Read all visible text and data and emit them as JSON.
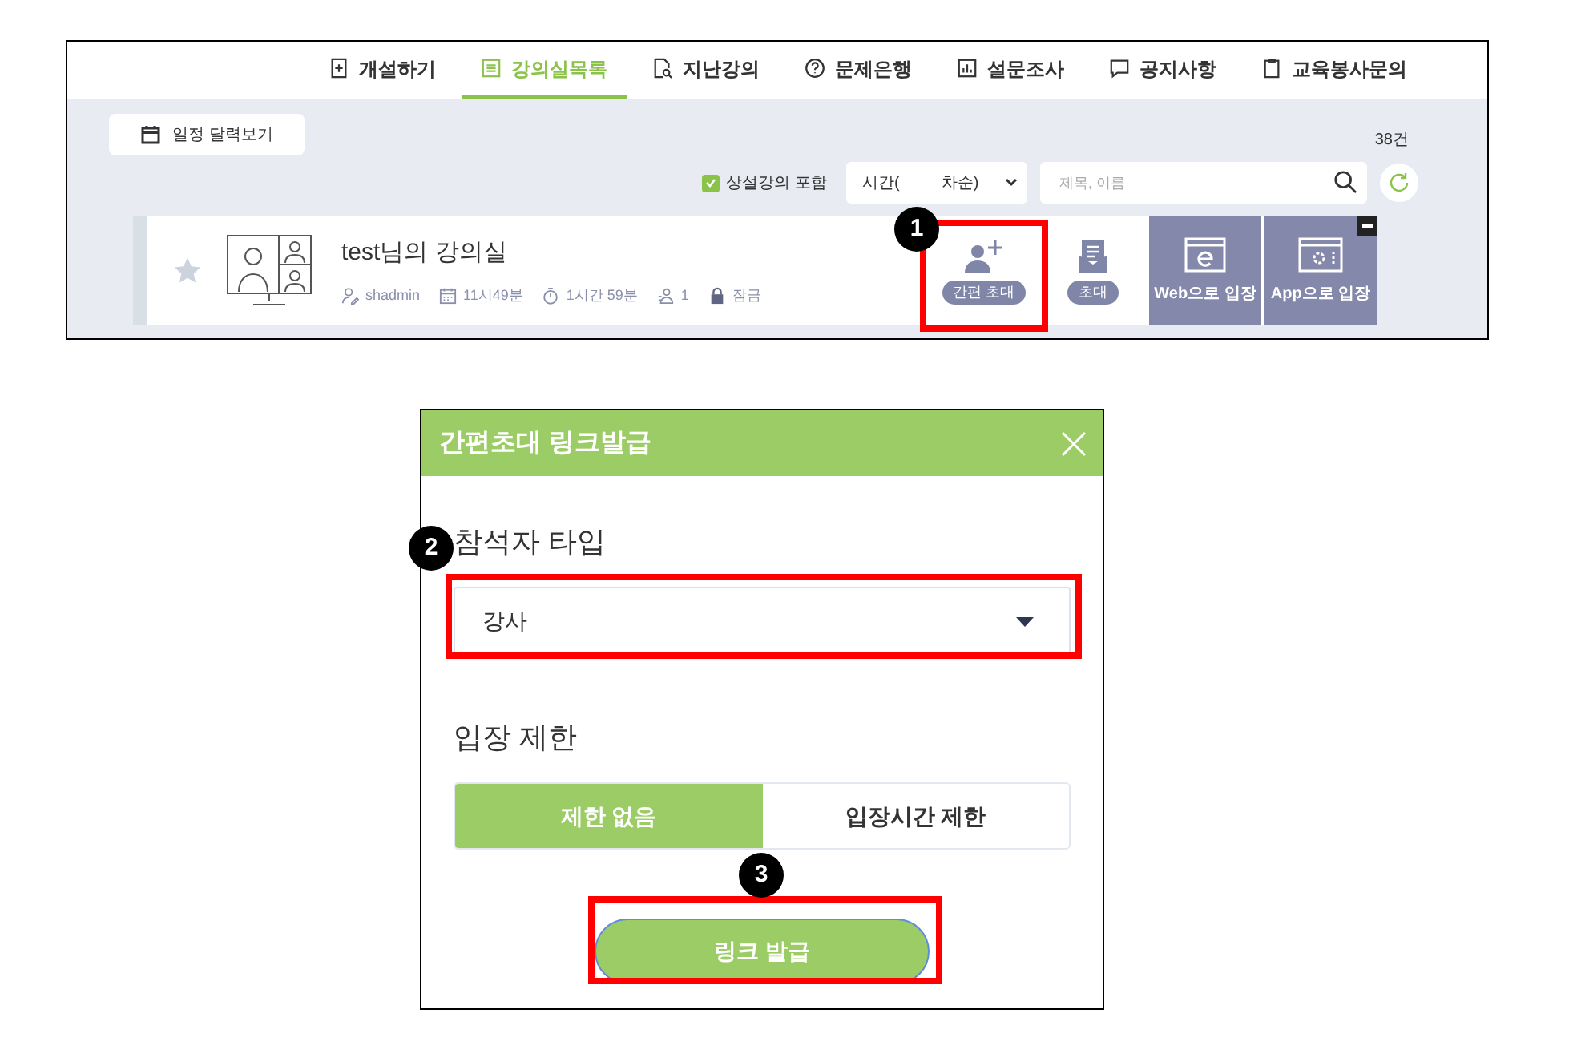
{
  "nav_tabs": [
    {
      "label": "개설하기",
      "selected": false
    },
    {
      "label": "강의실목록",
      "selected": true
    },
    {
      "label": "지난강의",
      "selected": false
    },
    {
      "label": "문제은행",
      "selected": false
    },
    {
      "label": "설문조사",
      "selected": false
    },
    {
      "label": "공지사항",
      "selected": false
    },
    {
      "label": "교육봉사문의",
      "selected": false
    }
  ],
  "calendar_button": "일정 달력보기",
  "count": "38건",
  "filters": {
    "include_permanent": {
      "label": "상설강의 포함",
      "checked": true
    },
    "sort": {
      "value_start": "시간(",
      "value_end": "차순)"
    },
    "search": {
      "placeholder": "제목, 이름"
    }
  },
  "classroom": {
    "starred": false,
    "title": "test님의 강의실",
    "meta": [
      "shadmin",
      "11시49분",
      "1시간 59분",
      "1",
      "잠금"
    ],
    "actions": [
      {
        "kind": "pill",
        "label": "간편 초대"
      },
      {
        "kind": "pill",
        "label": "초대"
      },
      {
        "kind": "tile",
        "label": "Web으로 입장"
      },
      {
        "kind": "tile",
        "label": "App으로 입장"
      }
    ]
  },
  "modal": {
    "title": "간편초대 링크발급",
    "participant_label": "참석자 타입",
    "participant_value": "강사",
    "limit_label": "입장 제한",
    "limit_options": [
      {
        "label": "제한 없음",
        "selected": true
      },
      {
        "label": "입장시간 제한",
        "selected": false
      }
    ],
    "submit": "링크 발급"
  },
  "steps": [
    "1",
    "2",
    "3"
  ]
}
